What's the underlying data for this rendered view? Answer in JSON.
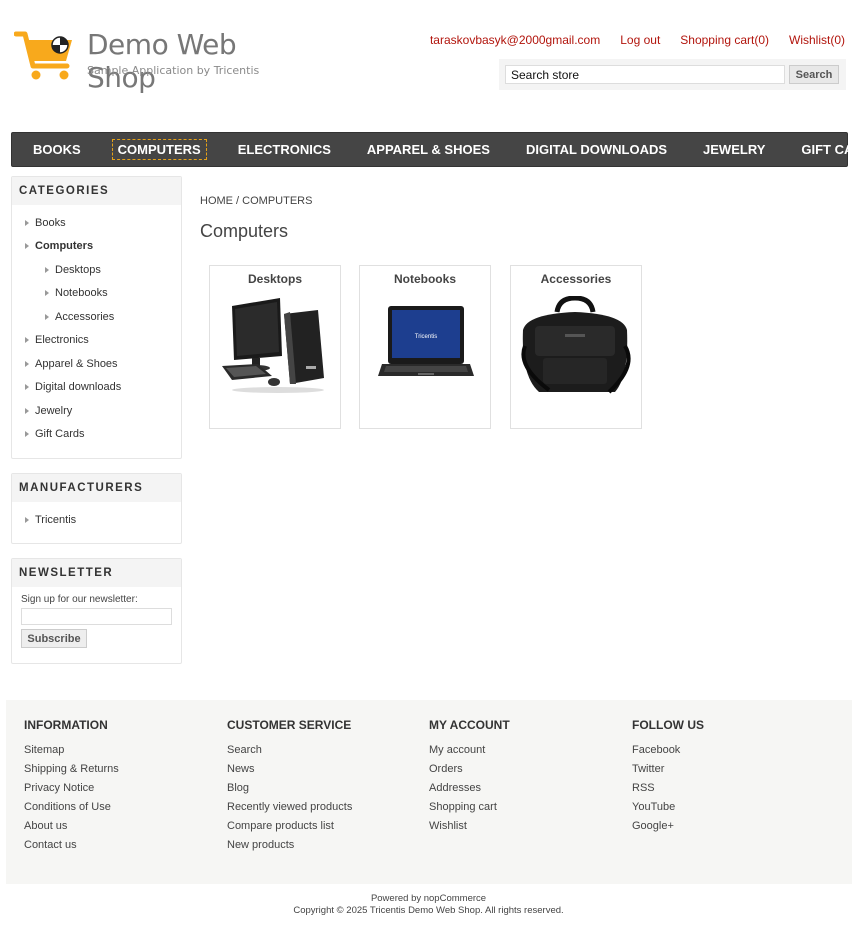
{
  "header": {
    "logo_title": "Demo Web Shop",
    "logo_subtitle": "Sample Application by Tricentis",
    "account_link": "taraskovbasyk@2000gmail.com",
    "logout_link": "Log out",
    "cart_link": "Shopping cart(0)",
    "wishlist_link": "Wishlist(0)",
    "search_value": "Search store",
    "search_button": "Search",
    "link_color": "#b2150d",
    "logo_color": "#f8a91c"
  },
  "menu": {
    "items": [
      "Books",
      "Computers",
      "Electronics",
      "Apparel & Shoes",
      "Digital downloads",
      "Jewelry",
      "Gift Cards"
    ],
    "active": "Computers"
  },
  "sidebar": {
    "categories_title": "Categories",
    "categories": {
      "books": "Books",
      "computers": "Computers",
      "desktops": "Desktops",
      "notebooks": "Notebooks",
      "accessories": "Accessories",
      "electronics": "Electronics",
      "apparel": "Apparel & Shoes",
      "digital": "Digital downloads",
      "jewelry": "Jewelry",
      "giftcards": "Gift Cards"
    },
    "manufacturers_title": "Manufacturers",
    "manufacturers": [
      "Tricentis"
    ],
    "newsletter_title": "Newsletter",
    "newsletter_label": "Sign up for our newsletter:",
    "newsletter_button": "Subscribe"
  },
  "main": {
    "breadcrumb": "Home / Computers",
    "title": "Computers",
    "subcategories": [
      "Desktops",
      "Notebooks",
      "Accessories"
    ],
    "notebook_screen_text": "Tricentis"
  },
  "footer": {
    "columns": [
      {
        "title": "Information",
        "links": [
          "Sitemap",
          "Shipping & Returns",
          "Privacy Notice",
          "Conditions of Use",
          "About us",
          "Contact us"
        ]
      },
      {
        "title": "Customer service",
        "links": [
          "Search",
          "News",
          "Blog",
          "Recently viewed products",
          "Compare products list",
          "New products"
        ]
      },
      {
        "title": "My account",
        "links": [
          "My account",
          "Orders",
          "Addresses",
          "Shopping cart",
          "Wishlist"
        ]
      },
      {
        "title": "Follow us",
        "links": [
          "Facebook",
          "Twitter",
          "RSS",
          "YouTube",
          "Google+"
        ]
      }
    ],
    "powered": "Powered by nopCommerce",
    "copyright": "Copyright © 2025 Tricentis Demo Web Shop. All rights reserved."
  }
}
